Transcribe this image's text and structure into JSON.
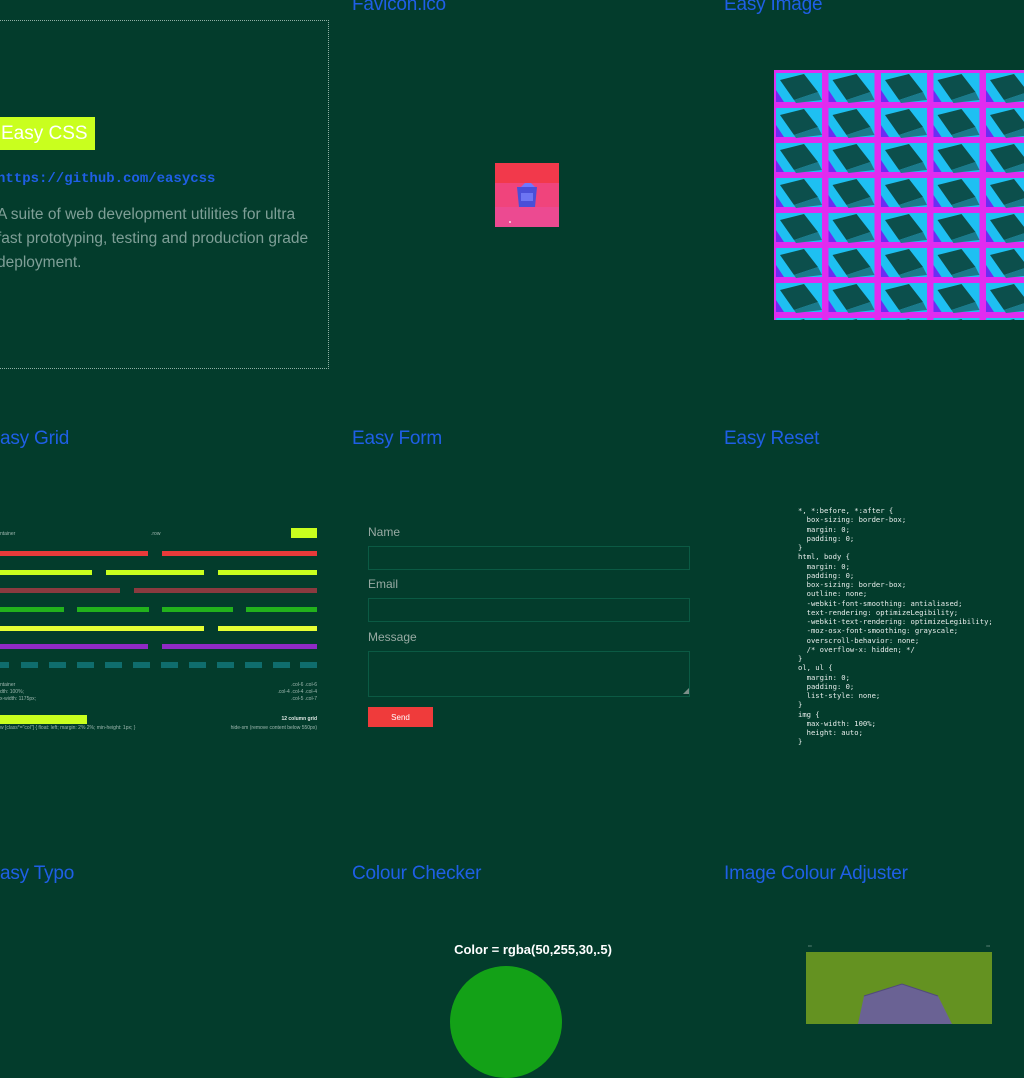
{
  "titles": {
    "favicon": "Favicon.ico",
    "easy_image": "Easy Image",
    "easy_grid": "asy Grid",
    "easy_form": "Easy Form",
    "easy_reset": "Easy Reset",
    "easy_typo": "asy Typo",
    "colour_checker": "Colour Checker",
    "image_colour_adjuster": "Image Colour Adjuster"
  },
  "intro": {
    "badge": "Easy CSS",
    "url": "https://github.com/easycss",
    "description": "A suite of web development utilities for ultra fast prototyping, testing and production grade deployment."
  },
  "grid_demo": {
    "container_label": "ntainer",
    "row_label": ".row",
    "info_left": [
      "ntainer",
      "dth: 100%;",
      "x-width: 1175px;"
    ],
    "info_right": [
      ".col-6 .col-6",
      ".col-4 .col-4 .col-4",
      ".col-5 .col-7"
    ],
    "grid_title": "12 column grid",
    "row_rule": "w [class*=\"col\"] { float: left; margin: 2% 2%; min-height: 1px; }",
    "hide_rule": "hide-sm (remove content below 550px)"
  },
  "form": {
    "name_label": "Name",
    "email_label": "Email",
    "message_label": "Message",
    "send_label": "Send"
  },
  "reset_code": "*, *:before, *:after {\n  box-sizing: border-box;\n  margin: 0;\n  padding: 0;\n}\nhtml, body {\n  margin: 0;\n  padding: 0;\n  box-sizing: border-box;\n  outline: none;\n  -webkit-font-smoothing: antialiased;\n  text-rendering: optimizeLegibility;\n  -webkit-text-rendering: optimizeLegibility;\n  -moz-osx-font-smoothing: grayscale;\n  overscroll-behavior: none;\n  /* overflow-x: hidden; */\n}\nol, ul {\n  margin: 0;\n  padding: 0;\n  list-style: none;\n}\nimg {\n  max-width: 100%;\n  height: auto;\n}",
  "colour_checker": {
    "label": "Color = rgba(50,255,30,.5)",
    "swatch_color": "#13a117"
  },
  "colors": {
    "background": "#033c2c",
    "title_blue": "#1f5fe6",
    "accent_lime": "#c9ff1e",
    "send_red": "#ef3b3b"
  }
}
